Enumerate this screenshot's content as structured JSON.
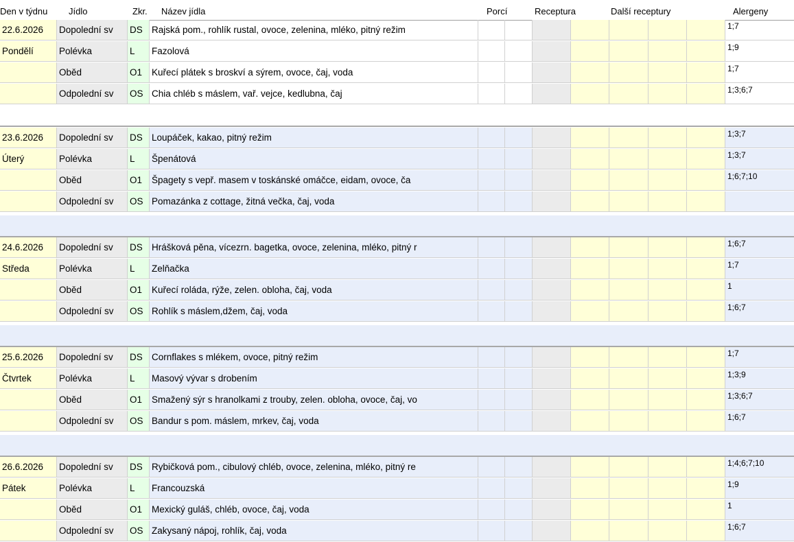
{
  "header": {
    "den": "Den v týdnu",
    "jidlo": "Jídlo",
    "zkr": "Zkr.",
    "nazev": "Název jídla",
    "porci": "Porcí",
    "receptura": "Receptura",
    "dalsi": "Další receptury",
    "alergeny": "Alergeny"
  },
  "days": [
    {
      "date": "22.6.2026",
      "weekday": "Pondělí",
      "rows": [
        {
          "jidlo": "Dopolední sv",
          "zkr": "DS",
          "nazev": "Rajská pom., rohlík rustal, ovoce, zelenina, mléko, pitný režim",
          "alergeny": "1;7"
        },
        {
          "jidlo": "Polévka",
          "zkr": "L",
          "nazev": "Fazolová",
          "alergeny": "1;9"
        },
        {
          "jidlo": "Oběd",
          "zkr": "O1",
          "nazev": "Kuřecí plátek s broskví a sýrem, ovoce, čaj, voda",
          "alergeny": "1;7"
        },
        {
          "jidlo": "Odpolední sv",
          "zkr": "OS",
          "nazev": "Chia chléb s máslem, vař. vejce, kedlubna, čaj",
          "alergeny": "1;3;6;7"
        }
      ]
    },
    {
      "date": "23.6.2026",
      "weekday": "Úterý",
      "rows": [
        {
          "jidlo": "Dopolední sv",
          "zkr": "DS",
          "nazev": "Loupáček, kakao, pitný režim",
          "alergeny": "1;3;7"
        },
        {
          "jidlo": "Polévka",
          "zkr": "L",
          "nazev": "Špenátová",
          "alergeny": "1;3;7"
        },
        {
          "jidlo": "Oběd",
          "zkr": "O1",
          "nazev": "Špagety s vepř. masem v toskánské omáčce, eidam, ovoce, ča",
          "alergeny": "1;6;7;10"
        },
        {
          "jidlo": "Odpolední sv",
          "zkr": "OS",
          "nazev": "Pomazánka z cottage, žitná večka, čaj, voda",
          "alergeny": ""
        }
      ]
    },
    {
      "date": "24.6.2026",
      "weekday": "Středa",
      "rows": [
        {
          "jidlo": "Dopolední sv",
          "zkr": "DS",
          "nazev": "Hrášková pěna, vícezrn. bagetka, ovoce, zelenina, mléko, pitný r",
          "alergeny": "1;6;7"
        },
        {
          "jidlo": "Polévka",
          "zkr": "L",
          "nazev": "Zelňačka",
          "alergeny": "1;7"
        },
        {
          "jidlo": "Oběd",
          "zkr": "O1",
          "nazev": "Kuřecí roláda, rýže, zelen. obloha, čaj, voda",
          "alergeny": "1"
        },
        {
          "jidlo": "Odpolední sv",
          "zkr": "OS",
          "nazev": "Rohlík s máslem,džem, čaj, voda",
          "alergeny": "1;6;7"
        }
      ]
    },
    {
      "date": "25.6.2026",
      "weekday": "Čtvrtek",
      "rows": [
        {
          "jidlo": "Dopolední sv",
          "zkr": "DS",
          "nazev": "Cornflakes s mlékem, ovoce, pitný režim",
          "alergeny": "1;7"
        },
        {
          "jidlo": "Polévka",
          "zkr": "L",
          "nazev": "Masový vývar s drobením",
          "alergeny": "1;3;9"
        },
        {
          "jidlo": "Oběd",
          "zkr": "O1",
          "nazev": "Smažený sýr s hranolkami z trouby, zelen. obloha, ovoce, čaj, vo",
          "alergeny": "1;3;6;7"
        },
        {
          "jidlo": "Odpolední sv",
          "zkr": "OS",
          "nazev": "Bandur s pom. máslem, mrkev, čaj, voda",
          "alergeny": "1;6;7"
        }
      ]
    },
    {
      "date": "26.6.2026",
      "weekday": "Pátek",
      "rows": [
        {
          "jidlo": "Dopolední sv",
          "zkr": "DS",
          "nazev": "Rybičková pom., cibulový chléb, ovoce, zelenina, mléko, pitný re",
          "alergeny": "1;4;6;7;10"
        },
        {
          "jidlo": "Polévka",
          "zkr": "L",
          "nazev": "Francouzská",
          "alergeny": "1;9"
        },
        {
          "jidlo": "Oběd",
          "zkr": "O1",
          "nazev": "Mexický guláš, chléb, ovoce, čaj, voda",
          "alergeny": "1"
        },
        {
          "jidlo": "Odpolední sv",
          "zkr": "OS",
          "nazev": "Zakysaný nápoj, rohlík, čaj, voda",
          "alergeny": "1;6;7"
        }
      ]
    }
  ]
}
